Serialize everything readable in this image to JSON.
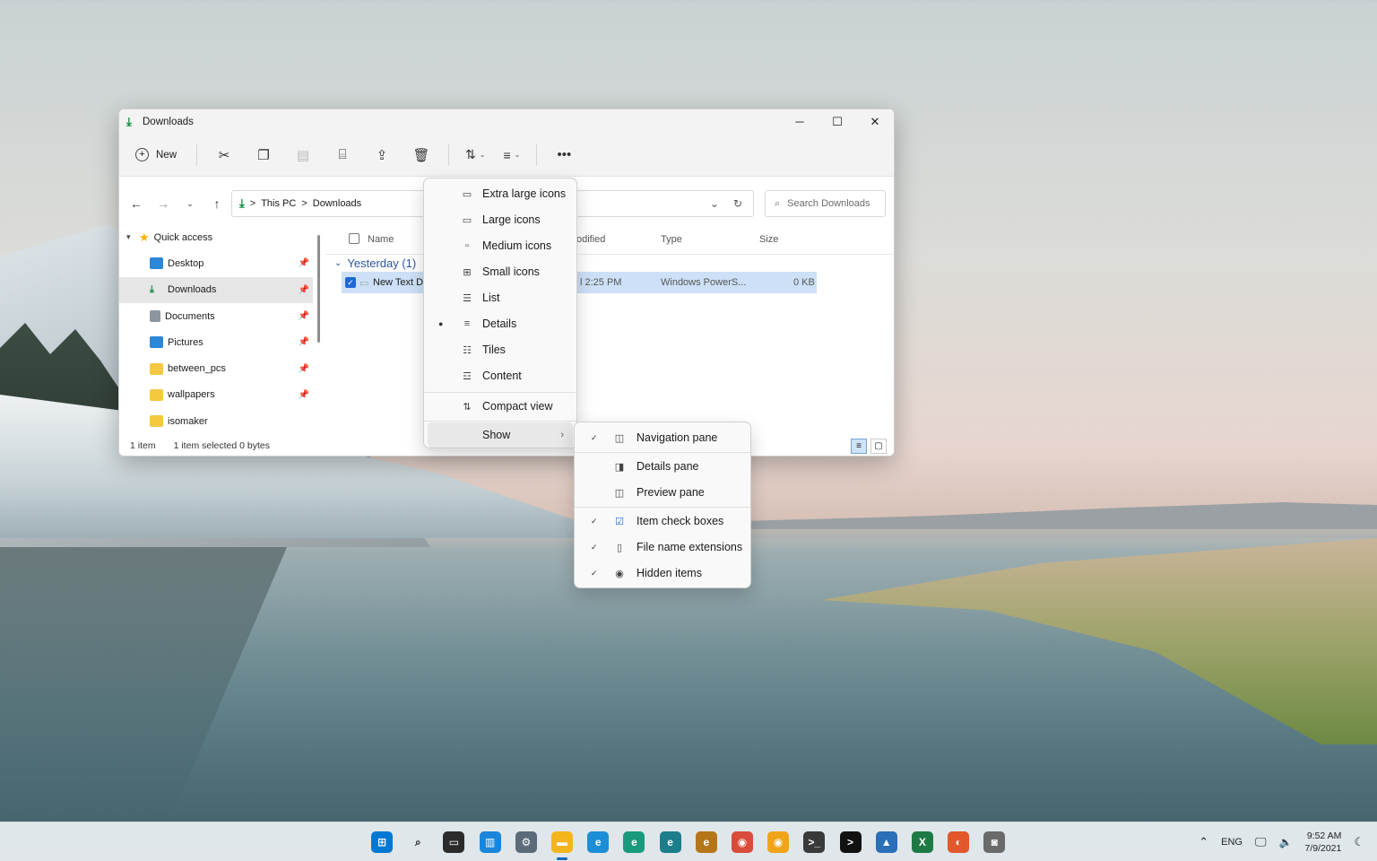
{
  "window": {
    "title": "Downloads",
    "controls": [
      "─",
      "☐",
      "✕"
    ]
  },
  "toolbar": {
    "new_label": "New"
  },
  "address": {
    "sep": ">",
    "crumbs": [
      "This PC",
      "Downloads"
    ],
    "search_placeholder": "Search Downloads"
  },
  "sidebar": {
    "items": [
      {
        "label": "Quick access",
        "icon": "star-icon",
        "color": "#f2b400"
      },
      {
        "label": "Desktop",
        "icon": "desktop-icon",
        "color": "#2b88d8"
      },
      {
        "label": "Downloads",
        "icon": "download-icon",
        "color": "#0a8a3c"
      },
      {
        "label": "Documents",
        "icon": "document-icon",
        "color": "#6f7b85"
      },
      {
        "label": "Pictures",
        "icon": "pictures-icon",
        "color": "#2b88d8"
      },
      {
        "label": "between_pcs",
        "icon": "folder-icon",
        "color": "#f5c842"
      },
      {
        "label": "wallpapers",
        "icon": "folder-icon",
        "color": "#f5c842"
      },
      {
        "label": "isomaker",
        "icon": "folder-icon",
        "color": "#f5c842"
      }
    ]
  },
  "columns": {
    "name": "Name",
    "modified": "odified",
    "type": "Type",
    "size": "Size"
  },
  "group": {
    "label": "Yesterday (1)"
  },
  "file": {
    "name": "New Text Do",
    "modified": "l 2:25 PM",
    "type": "Windows PowerS...",
    "size": "0 KB"
  },
  "status": {
    "count": "1 item",
    "selected": "1 item selected  0 bytes"
  },
  "view_menu": {
    "items": [
      {
        "label": "Extra large icons",
        "icon": "monitor-icon"
      },
      {
        "label": "Large icons",
        "icon": "monitor-icon"
      },
      {
        "label": "Medium icons",
        "icon": "monitor-icon"
      },
      {
        "label": "Small icons",
        "icon": "grid-icon"
      },
      {
        "label": "List",
        "icon": "list-icon"
      },
      {
        "label": "Details",
        "icon": "details-icon",
        "selected": true
      },
      {
        "label": "Tiles",
        "icon": "tiles-icon"
      },
      {
        "label": "Content",
        "icon": "content-icon"
      },
      {
        "label": "Compact view",
        "icon": "compact-icon"
      },
      {
        "label": "Show",
        "icon": "",
        "submenu": true
      }
    ]
  },
  "show_menu": {
    "items": [
      {
        "label": "Navigation pane",
        "checked": true
      },
      {
        "label": "Details pane",
        "checked": false
      },
      {
        "label": "Preview pane",
        "checked": false
      },
      {
        "label": "Item check boxes",
        "checked": true
      },
      {
        "label": "File name extensions",
        "checked": true
      },
      {
        "label": "Hidden items",
        "checked": true
      }
    ]
  },
  "taskbar": {
    "apps": [
      {
        "name": "start",
        "color": "#0078d4",
        "glyph": "⊞"
      },
      {
        "name": "search",
        "color": "transparent",
        "glyph": "⌕"
      },
      {
        "name": "task-view",
        "color": "#2b2b2b",
        "glyph": "▭"
      },
      {
        "name": "widgets",
        "color": "#1a86d9",
        "glyph": "▥"
      },
      {
        "name": "settings",
        "color": "#5b6b7a",
        "glyph": "⚙"
      },
      {
        "name": "file-explorer",
        "color": "#f3b51b",
        "glyph": "▬",
        "active": true
      },
      {
        "name": "edge",
        "color": "#1c8ed6",
        "glyph": "e"
      },
      {
        "name": "edge-beta",
        "color": "#1a9a7d",
        "glyph": "e"
      },
      {
        "name": "edge-dev",
        "color": "#1b7e8a",
        "glyph": "e"
      },
      {
        "name": "edge-canary",
        "color": "#b5761a",
        "glyph": "e"
      },
      {
        "name": "chrome",
        "color": "#d94b3a",
        "glyph": "◉"
      },
      {
        "name": "chrome-canary",
        "color": "#f0a419",
        "glyph": "◉"
      },
      {
        "name": "terminal",
        "color": "#3a3a3a",
        "glyph": ">_"
      },
      {
        "name": "command-prompt",
        "color": "#111111",
        "glyph": ">"
      },
      {
        "name": "photos",
        "color": "#2a6fb8",
        "glyph": "▲"
      },
      {
        "name": "excel",
        "color": "#1e7a45",
        "glyph": "X"
      },
      {
        "name": "firefox",
        "color": "#e2572c",
        "glyph": "◐"
      },
      {
        "name": "camera",
        "color": "#6a6a6a",
        "glyph": "◙"
      }
    ],
    "tray": {
      "lang": "ENG",
      "time": "9:52 AM",
      "date": "7/9/2021"
    }
  }
}
